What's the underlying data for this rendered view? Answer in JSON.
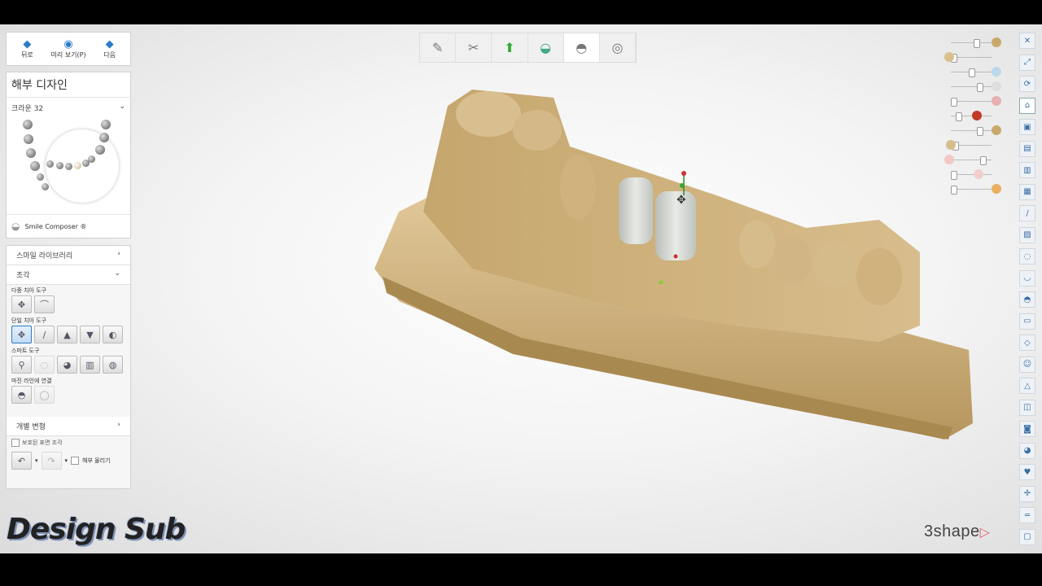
{
  "nav": {
    "back_label": "뒤로",
    "preview_label": "미리 보기(P)",
    "next_label": "다음"
  },
  "design": {
    "title": "해부 디자인",
    "selector_label": "크라운 32",
    "smile_composer_label": "Smile Composer ®"
  },
  "tools": {
    "smile_library_label": "스마일 라이브러리",
    "sculpt_label": "조각",
    "multi_tooth_label": "다중 치아 도구",
    "single_tooth_label": "단일 치아 도구",
    "smart_label": "스마트 도구",
    "margin_label": "마진 라인에 연결",
    "individual_label": "개별 변형",
    "protect_surface_label": "보호된 표면 조각",
    "lift_anatomy_label": "해부 올리기"
  },
  "branding": {
    "logo_text": "3shape",
    "watermark_text": "Design Sub"
  },
  "colors": {
    "accent": "#2b7bc9",
    "model": "#cdb07a",
    "crown": "#d3d6d0",
    "viewport_bg": "#f4f4f4"
  },
  "icons": {
    "workflow": [
      "margin-pen-icon",
      "scissors-icon",
      "insertion-direction-icon",
      "gingiva-icon",
      "crown-icon",
      "sphere-icon"
    ],
    "right_tools": [
      "close-icon",
      "fit-view-icon",
      "rotate-view-icon",
      "graduation-cap-icon",
      "front-view-icon",
      "back-view-icon",
      "side-view-icon",
      "occlusal-view-icon",
      "clip-icon",
      "color-map-icon",
      "contact-icon",
      "smile-icon",
      "crown-icon",
      "section-icon",
      "measure-icon",
      "face-icon",
      "alert-icon",
      "layer-icon",
      "camera-icon",
      "palette-icon",
      "heart-icon",
      "cross-section-icon",
      "ruler-icon",
      "screenshot-icon"
    ]
  }
}
